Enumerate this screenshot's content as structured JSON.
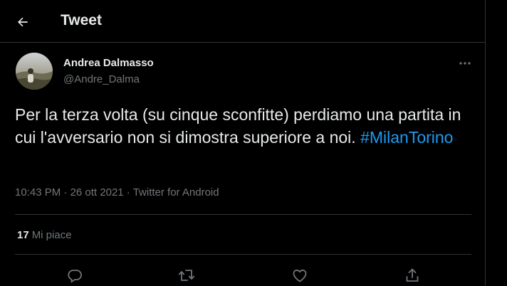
{
  "header": {
    "title": "Tweet"
  },
  "tweet": {
    "author_name": "Andrea Dalmasso",
    "author_handle": "@Andre_Dalma",
    "text_before": "Per la terza volta (su cinque sconfitte) perdiamo una partita in cui l'avversario non si dimostra superiore a noi. ",
    "hashtag": "#MilanTorino",
    "time": "10:43 PM",
    "separator": " · ",
    "date": "26 ott 2021",
    "source": "Twitter for Android",
    "likes_count": "17",
    "likes_label": "Mi piace"
  },
  "icons": {
    "back": "arrow-left-icon",
    "more": "more-horizontal-icon",
    "reply": "reply-icon",
    "retweet": "retweet-icon",
    "like": "heart-icon",
    "share": "share-icon"
  },
  "colors": {
    "background": "#000000",
    "text": "#e7e9ea",
    "secondary": "#71767b",
    "border": "#2f3336",
    "link": "#1d9bf0"
  }
}
